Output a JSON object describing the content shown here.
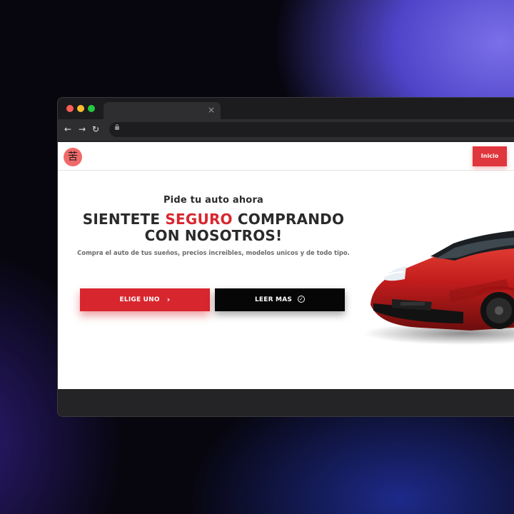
{
  "browser": {
    "tab_close_glyph": "×",
    "nav": {
      "back": "←",
      "forward": "→",
      "reload": "↻"
    }
  },
  "site": {
    "logo_glyph": "苦",
    "nav_button": "Inicio"
  },
  "hero": {
    "kicker": "Pide tu auto ahora",
    "headline_part1": "SIENTETE ",
    "headline_accent": "SEGURO",
    "headline_part2": " COMPRANDO",
    "headline_line2": "CON NOSOTROS!",
    "description": "Compra el auto de tus sueños, precios increibles, modelos unicos y de todo tipo.",
    "primary_cta": "ELIGE UNO",
    "primary_cta_icon": "›",
    "secondary_cta": "LEER MAS",
    "secondary_cta_icon": "✓"
  },
  "colors": {
    "accent": "#d8262e",
    "inicio": "#e0363d",
    "dark_button": "#060606",
    "logo_bg": "#f06a6a",
    "car_body": "#c31d1d"
  },
  "icons": {
    "logo": "logo-icon",
    "car": "sports-car-image",
    "chevron": "chevron-right-icon",
    "check": "check-circle-icon",
    "lock": "lock-icon"
  }
}
